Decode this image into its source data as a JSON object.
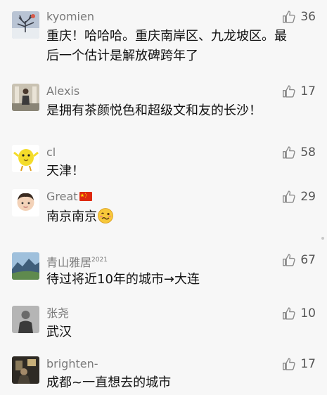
{
  "comments": [
    {
      "user": "kyomien",
      "likes": "36",
      "text_line1": "重庆！哈哈哈。重庆南岸区、九龙坡区。最",
      "text_line2": "后一个估计是解放碑跨年了",
      "avatar": "winter-tree-photo"
    },
    {
      "user": "Alexis",
      "likes": "17",
      "text": "是拥有茶颜悦色和超级文和友的长沙！",
      "avatar": "person-portrait-photo"
    },
    {
      "user": "cl",
      "likes": "58",
      "text": "天津！",
      "avatar": "yellow-chick-cartoon"
    },
    {
      "user": "Great",
      "user_flag": "china-flag-emoji",
      "likes": "29",
      "text": "南京南京",
      "text_emoji": "woozy-face-emoji",
      "avatar": "boy-emoji"
    },
    {
      "user": "青山雅居",
      "user_sup": "2021",
      "likes": "67",
      "text": "待过将近10年的城市→大连",
      "avatar": "mountain-landscape-photo"
    },
    {
      "user": "张尧",
      "likes": "10",
      "text": "武汉",
      "avatar": "grayscale-portrait-photo"
    },
    {
      "user": "brighten-",
      "likes": "17",
      "text": "成都~一直想去的城市",
      "avatar": "dark-interior-photo"
    }
  ],
  "colors": {
    "background": "#f7f7f7",
    "username": "#7a7a7a",
    "text": "#111111",
    "like_icon": "#8a8a8a"
  }
}
